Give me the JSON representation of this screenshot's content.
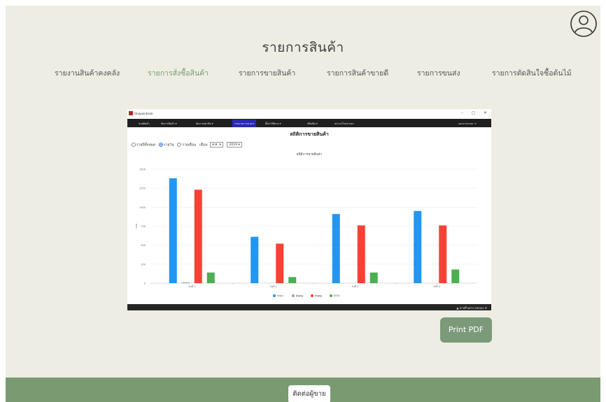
{
  "header": {
    "user_icon": "user-circle-icon"
  },
  "page_title": "รายการสินค้า",
  "nav": [
    {
      "label": "รายงานสินค้าคงคลัง",
      "active": false
    },
    {
      "label": "รายการสั่งซื้อสินค้า",
      "active": true
    },
    {
      "label": "รายการขายสินค้า",
      "active": false
    },
    {
      "label": "รายการสินค้าขายดี",
      "active": false
    },
    {
      "label": "รายการขนส่ง",
      "active": false
    },
    {
      "label": "รายการตัดสินใจซื้อต้นไม้",
      "active": false
    }
  ],
  "app": {
    "window_title": "Onepointsale",
    "window_controls": [
      "–",
      "◻",
      "✕"
    ],
    "menu": [
      "ขายสินค้า",
      "จัดการสินค้า ▾",
      "จัดการสมาชิก ▾",
      "รายงานการขาย ▾",
      "ตั้งค่าวิธีขาย ▾",
      "เพิ่มเติม ▾",
      "สถานะใบประกอบ",
      "ออกจากระบบ ⇥"
    ],
    "report_title": "สถิติการขายสินค้า",
    "filters": {
      "options": [
        "รายปีทั้งหมด",
        "รายวัน",
        "รายเดือน"
      ],
      "selected": "รายวัน",
      "month_label": "เดือน",
      "month_value": "ต.ค. ▾",
      "year_value": "2019 ▾"
    },
    "status_text": "▲ พาสติ้วอย่าง ทดลอง ☰"
  },
  "chart_data": {
    "type": "bar",
    "title": "สถิติการขายสินค้า",
    "categories": [
      "วันที่ 1",
      "วันที่ 2",
      "วันที่ 3",
      "วันที่ 4"
    ],
    "ylim": [
      0,
      1500
    ],
    "yticks": [
      0,
      250,
      500,
      750,
      1000,
      1250,
      1500
    ],
    "ylabel": "บาท",
    "legend_position": "bottom",
    "series": [
      {
        "name": "ราคา",
        "color": "#2196f3",
        "values": [
          1380,
          610,
          910,
          950
        ]
      },
      {
        "name": "ต้นทุน",
        "color": "#9e9e9e",
        "values": [
          10,
          0,
          0,
          0
        ]
      },
      {
        "name": "ต้นทุน",
        "color": "#f44336",
        "values": [
          1230,
          520,
          760,
          760
        ]
      },
      {
        "name": "กำไร",
        "color": "#4caf50",
        "values": [
          140,
          80,
          140,
          180
        ]
      }
    ]
  },
  "print_label": "Print PDF",
  "footer": {
    "contact_label": "ติดต่อผู้ขาย"
  }
}
